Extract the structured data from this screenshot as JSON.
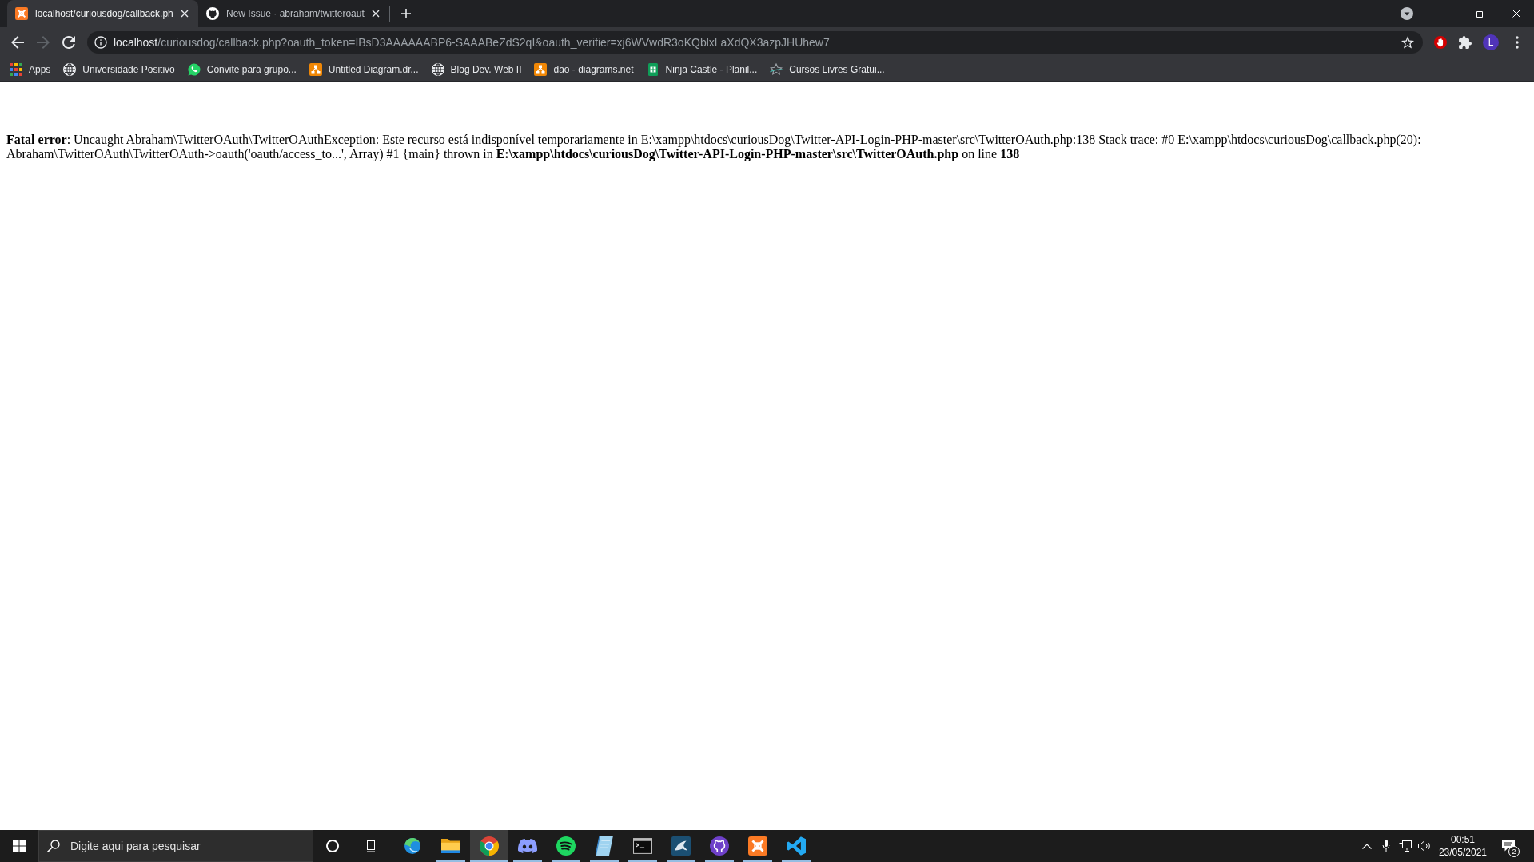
{
  "tabs": [
    {
      "kind": "xlogo",
      "title": "localhost/curiousdog/callback.ph",
      "selected": true
    },
    {
      "kind": "cat",
      "title": "New Issue · abraham/twitteroaut",
      "selected": false
    }
  ],
  "toolbar": {
    "nav": [
      {
        "kind": "back",
        "disabled": false
      },
      {
        "kind": "forward",
        "disabled": true
      },
      {
        "kind": "reload",
        "disabled": false
      }
    ],
    "url": {
      "host": "localhost",
      "rest": "/curiousdog/callback.php?oauth_token=IBsD3AAAAAABP6-SAAABeZdS2qI&oauth_verifier=xj6WVwdR3oKQblxLaXdQX3azpJHUhew7"
    },
    "profile": {
      "initial": "L"
    }
  },
  "bookmarks": [
    {
      "kind": "apps",
      "label": "Apps"
    },
    {
      "kind": "globe",
      "label": "Universidade Positivo"
    },
    {
      "kind": "chat",
      "label": "Convite para grupo..."
    },
    {
      "kind": "diagram",
      "label": "Untitled Diagram.dr..."
    },
    {
      "kind": "globe",
      "label": "Blog Dev. Web II"
    },
    {
      "kind": "diagram",
      "label": "dao - diagrams.net"
    },
    {
      "kind": "sheet",
      "label": "Ninja Castle - Planil..."
    },
    {
      "kind": "star",
      "label": "Cursos Livres Gratui..."
    }
  ],
  "page": {
    "error": "**Fatal error**: Uncaught Abraham\\TwitterOAuth\\TwitterOAuthException: Este recurso está indisponível temporariamente in E:\\xampp\\htdocs\\curiousDog\\Twitter-API-Login-PHP-master\\src\\TwitterOAuth.php:138 Stack trace: #0 E:\\xampp\\htdocs\\curiousDog\\callback.php(20): Abraham\\TwitterOAuth\\TwitterOAuth->oauth('oauth/access_to...', Array) #1 {main} thrown in **E:\\xampp\\htdocs\\curiousDog\\Twitter-API-Login-PHP-master\\src\\TwitterOAuth.php** on line **138**"
  },
  "taskbar": {
    "search": {
      "placeholder": "Digite aqui para pesquisar"
    },
    "apps": [
      {
        "kind": "swirl",
        "running": false,
        "selected": false
      },
      {
        "kind": "folder",
        "running": true,
        "selected": false
      },
      {
        "kind": "browser",
        "running": true,
        "selected": true
      },
      {
        "kind": "controller",
        "running": true,
        "selected": false
      },
      {
        "kind": "soundwaves",
        "running": true,
        "selected": false
      },
      {
        "kind": "notepad",
        "running": true,
        "selected": false
      },
      {
        "kind": "terminal",
        "running": true,
        "selected": false
      },
      {
        "kind": "fin",
        "running": true,
        "selected": false
      },
      {
        "kind": "cat",
        "running": true,
        "selected": false
      },
      {
        "kind": "xlogo",
        "running": true,
        "selected": false
      },
      {
        "kind": "ribbon",
        "running": true,
        "selected": false
      }
    ],
    "clock": {
      "time": "00:51",
      "date": "23/05/2021"
    },
    "notifications": {
      "count": "2"
    }
  }
}
